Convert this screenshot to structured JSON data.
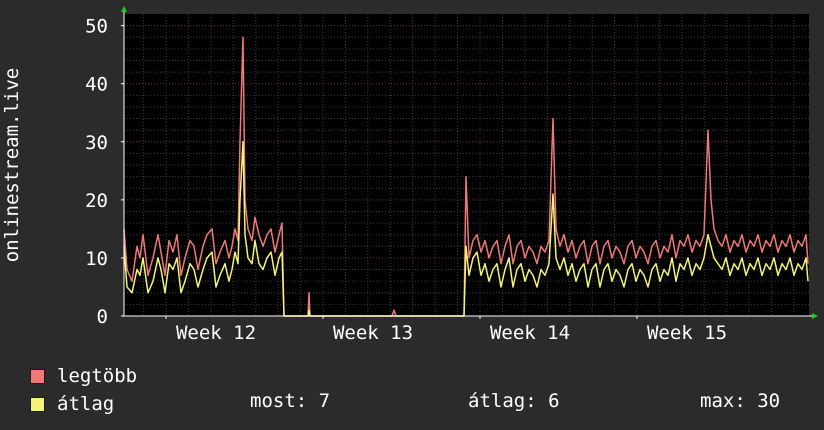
{
  "chart_data": {
    "type": "line",
    "ylabel": "onlinestream.live",
    "ylim": [
      0,
      52
    ],
    "yticks": [
      0,
      10,
      20,
      30,
      40,
      50
    ],
    "xlim": [
      0,
      685
    ],
    "x_ticks": [
      {
        "label": "Week 12",
        "x": 42
      },
      {
        "label": "Week 13",
        "x": 199
      },
      {
        "label": "Week 14",
        "x": 356
      },
      {
        "label": "Week 15",
        "x": 513
      }
    ],
    "grid": true,
    "series": [
      {
        "name": "legtöbb",
        "color": "#f07878",
        "points": [
          [
            0,
            15
          ],
          [
            3,
            8
          ],
          [
            8,
            6
          ],
          [
            13,
            12
          ],
          [
            16,
            10
          ],
          [
            19,
            14
          ],
          [
            24,
            7
          ],
          [
            29,
            10
          ],
          [
            34,
            14
          ],
          [
            37,
            11
          ],
          [
            41,
            7
          ],
          [
            45,
            13
          ],
          [
            49,
            11
          ],
          [
            53,
            14
          ],
          [
            57,
            7
          ],
          [
            61,
            10
          ],
          [
            66,
            13
          ],
          [
            70,
            12
          ],
          [
            74,
            8
          ],
          [
            79,
            12
          ],
          [
            83,
            14
          ],
          [
            88,
            15
          ],
          [
            92,
            9
          ],
          [
            96,
            11
          ],
          [
            101,
            13
          ],
          [
            105,
            10
          ],
          [
            108,
            12
          ],
          [
            111,
            15
          ],
          [
            114,
            13
          ],
          [
            116,
            30
          ],
          [
            119,
            48
          ],
          [
            121,
            20
          ],
          [
            124,
            15
          ],
          [
            128,
            13
          ],
          [
            131,
            17
          ],
          [
            135,
            14
          ],
          [
            139,
            12
          ],
          [
            143,
            14
          ],
          [
            147,
            15
          ],
          [
            151,
            11
          ],
          [
            155,
            14
          ],
          [
            158,
            16
          ],
          [
            160,
            0
          ],
          [
            184,
            0
          ],
          [
            185,
            4
          ],
          [
            186,
            0
          ],
          [
            268,
            0
          ],
          [
            270,
            1
          ],
          [
            272,
            0
          ],
          [
            340,
            0
          ],
          [
            342,
            24
          ],
          [
            345,
            10
          ],
          [
            349,
            13
          ],
          [
            353,
            14
          ],
          [
            357,
            11
          ],
          [
            361,
            13
          ],
          [
            365,
            10
          ],
          [
            369,
            12
          ],
          [
            373,
            13
          ],
          [
            377,
            9
          ],
          [
            381,
            12
          ],
          [
            385,
            14
          ],
          [
            389,
            9
          ],
          [
            393,
            12
          ],
          [
            397,
            13
          ],
          [
            401,
            10
          ],
          [
            405,
            12
          ],
          [
            409,
            11
          ],
          [
            413,
            9
          ],
          [
            417,
            12
          ],
          [
            421,
            11
          ],
          [
            425,
            13
          ],
          [
            429,
            34
          ],
          [
            432,
            15
          ],
          [
            436,
            12
          ],
          [
            440,
            14
          ],
          [
            444,
            11
          ],
          [
            448,
            13
          ],
          [
            452,
            10
          ],
          [
            456,
            12
          ],
          [
            460,
            13
          ],
          [
            464,
            9
          ],
          [
            468,
            12
          ],
          [
            472,
            13
          ],
          [
            476,
            9
          ],
          [
            480,
            12
          ],
          [
            484,
            13
          ],
          [
            488,
            10
          ],
          [
            492,
            12
          ],
          [
            496,
            11
          ],
          [
            500,
            9
          ],
          [
            504,
            12
          ],
          [
            508,
            13
          ],
          [
            512,
            10
          ],
          [
            516,
            12
          ],
          [
            520,
            11
          ],
          [
            524,
            9
          ],
          [
            528,
            12
          ],
          [
            532,
            13
          ],
          [
            536,
            10
          ],
          [
            540,
            12
          ],
          [
            544,
            11
          ],
          [
            548,
            14
          ],
          [
            552,
            10
          ],
          [
            556,
            13
          ],
          [
            560,
            12
          ],
          [
            564,
            14
          ],
          [
            568,
            11
          ],
          [
            572,
            13
          ],
          [
            576,
            12
          ],
          [
            580,
            14
          ],
          [
            584,
            32
          ],
          [
            587,
            20
          ],
          [
            590,
            15
          ],
          [
            594,
            13
          ],
          [
            598,
            12
          ],
          [
            602,
            14
          ],
          [
            606,
            11
          ],
          [
            610,
            13
          ],
          [
            614,
            12
          ],
          [
            618,
            14
          ],
          [
            622,
            11
          ],
          [
            626,
            13
          ],
          [
            630,
            12
          ],
          [
            634,
            14
          ],
          [
            638,
            11
          ],
          [
            642,
            13
          ],
          [
            646,
            12
          ],
          [
            650,
            14
          ],
          [
            654,
            11
          ],
          [
            658,
            13
          ],
          [
            662,
            12
          ],
          [
            666,
            14
          ],
          [
            670,
            11
          ],
          [
            674,
            13
          ],
          [
            678,
            12
          ],
          [
            682,
            14
          ],
          [
            684,
            9
          ]
        ]
      },
      {
        "name": "átlag",
        "color": "#f4f478",
        "points": [
          [
            0,
            12
          ],
          [
            3,
            5
          ],
          [
            8,
            4
          ],
          [
            13,
            8
          ],
          [
            16,
            7
          ],
          [
            19,
            10
          ],
          [
            24,
            4
          ],
          [
            29,
            6
          ],
          [
            34,
            10
          ],
          [
            37,
            8
          ],
          [
            41,
            4
          ],
          [
            45,
            9
          ],
          [
            49,
            8
          ],
          [
            53,
            10
          ],
          [
            57,
            4
          ],
          [
            61,
            6
          ],
          [
            66,
            9
          ],
          [
            70,
            8
          ],
          [
            74,
            5
          ],
          [
            79,
            8
          ],
          [
            83,
            10
          ],
          [
            88,
            11
          ],
          [
            92,
            5
          ],
          [
            96,
            7
          ],
          [
            101,
            9
          ],
          [
            105,
            6
          ],
          [
            108,
            8
          ],
          [
            111,
            11
          ],
          [
            114,
            9
          ],
          [
            116,
            20
          ],
          [
            119,
            30
          ],
          [
            121,
            14
          ],
          [
            124,
            10
          ],
          [
            128,
            9
          ],
          [
            131,
            13
          ],
          [
            135,
            9
          ],
          [
            139,
            8
          ],
          [
            143,
            10
          ],
          [
            147,
            11
          ],
          [
            151,
            7
          ],
          [
            155,
            10
          ],
          [
            158,
            11
          ],
          [
            160,
            0
          ],
          [
            184,
            0
          ],
          [
            185,
            1
          ],
          [
            186,
            0
          ],
          [
            268,
            0
          ],
          [
            270,
            0
          ],
          [
            272,
            0
          ],
          [
            340,
            0
          ],
          [
            342,
            12
          ],
          [
            345,
            7
          ],
          [
            349,
            10
          ],
          [
            353,
            11
          ],
          [
            357,
            7
          ],
          [
            361,
            9
          ],
          [
            365,
            6
          ],
          [
            369,
            8
          ],
          [
            373,
            9
          ],
          [
            377,
            5
          ],
          [
            381,
            8
          ],
          [
            385,
            10
          ],
          [
            389,
            5
          ],
          [
            393,
            8
          ],
          [
            397,
            9
          ],
          [
            401,
            6
          ],
          [
            405,
            8
          ],
          [
            409,
            7
          ],
          [
            413,
            5
          ],
          [
            417,
            8
          ],
          [
            421,
            7
          ],
          [
            425,
            9
          ],
          [
            429,
            21
          ],
          [
            432,
            10
          ],
          [
            436,
            8
          ],
          [
            440,
            10
          ],
          [
            444,
            7
          ],
          [
            448,
            9
          ],
          [
            452,
            6
          ],
          [
            456,
            8
          ],
          [
            460,
            9
          ],
          [
            464,
            5
          ],
          [
            468,
            8
          ],
          [
            472,
            9
          ],
          [
            476,
            5
          ],
          [
            480,
            8
          ],
          [
            484,
            9
          ],
          [
            488,
            6
          ],
          [
            492,
            8
          ],
          [
            496,
            7
          ],
          [
            500,
            5
          ],
          [
            504,
            8
          ],
          [
            508,
            9
          ],
          [
            512,
            6
          ],
          [
            516,
            8
          ],
          [
            520,
            7
          ],
          [
            524,
            5
          ],
          [
            528,
            8
          ],
          [
            532,
            9
          ],
          [
            536,
            6
          ],
          [
            540,
            8
          ],
          [
            544,
            7
          ],
          [
            548,
            10
          ],
          [
            552,
            6
          ],
          [
            556,
            9
          ],
          [
            560,
            8
          ],
          [
            564,
            10
          ],
          [
            568,
            7
          ],
          [
            572,
            9
          ],
          [
            576,
            8
          ],
          [
            580,
            10
          ],
          [
            584,
            14
          ],
          [
            587,
            12
          ],
          [
            590,
            10
          ],
          [
            594,
            9
          ],
          [
            598,
            8
          ],
          [
            602,
            10
          ],
          [
            606,
            7
          ],
          [
            610,
            9
          ],
          [
            614,
            8
          ],
          [
            618,
            10
          ],
          [
            622,
            7
          ],
          [
            626,
            9
          ],
          [
            630,
            8
          ],
          [
            634,
            10
          ],
          [
            638,
            7
          ],
          [
            642,
            9
          ],
          [
            646,
            8
          ],
          [
            650,
            10
          ],
          [
            654,
            7
          ],
          [
            658,
            9
          ],
          [
            662,
            8
          ],
          [
            666,
            10
          ],
          [
            670,
            7
          ],
          [
            674,
            9
          ],
          [
            678,
            8
          ],
          [
            682,
            10
          ],
          [
            684,
            6
          ]
        ]
      }
    ]
  },
  "legend": {
    "max_label": "legtöbb",
    "avg_label": "átlag",
    "max_color": "#f07878",
    "avg_color": "#f4f478"
  },
  "stats": {
    "now": "most: 7",
    "avg": "átlag: 6",
    "max": "max: 30"
  }
}
